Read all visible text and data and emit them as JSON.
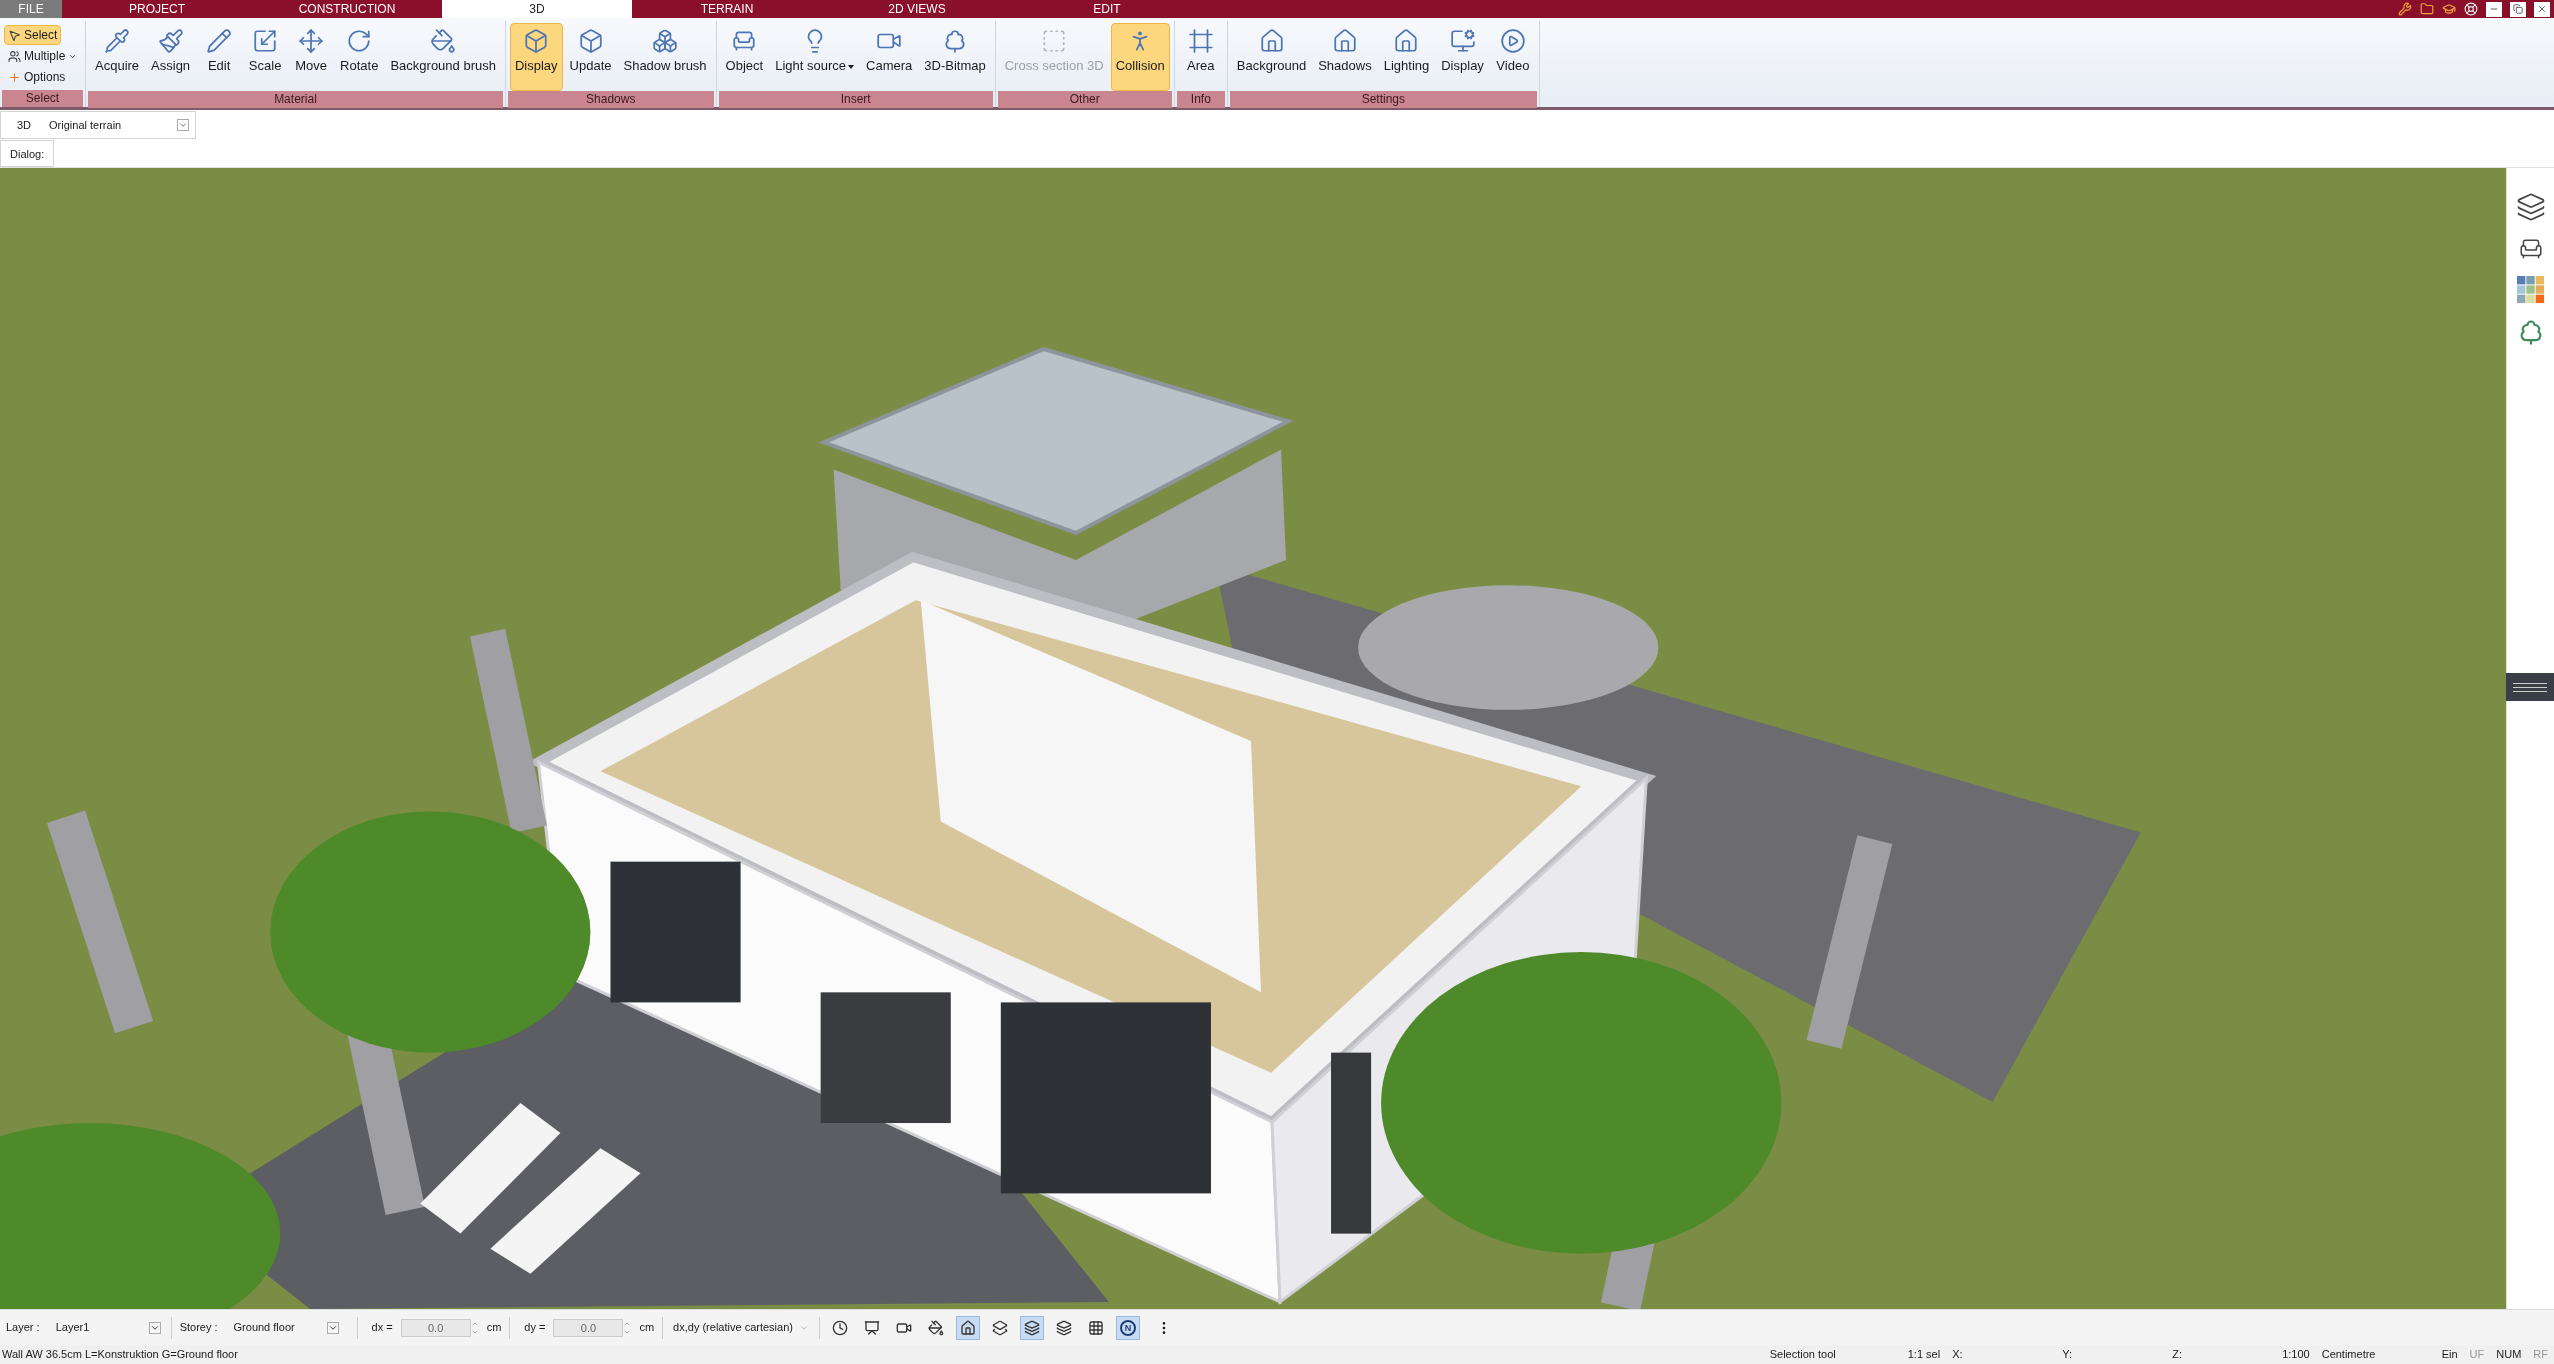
{
  "tabs": [
    {
      "label": "FILE",
      "selected": false,
      "kind": "file"
    },
    {
      "label": "PROJECT",
      "selected": false,
      "kind": "tab"
    },
    {
      "label": "CONSTRUCTION",
      "selected": false,
      "kind": "tab"
    },
    {
      "label": "3D",
      "selected": true,
      "kind": "tab"
    },
    {
      "label": "TERRAIN",
      "selected": false,
      "kind": "tab"
    },
    {
      "label": "2D VIEWS",
      "selected": false,
      "kind": "tab"
    },
    {
      "label": "EDIT",
      "selected": false,
      "kind": "tab"
    }
  ],
  "select_group": {
    "label": "Select",
    "items": [
      {
        "label": "Select",
        "selected": true
      },
      {
        "label": "Multiple",
        "selected": false,
        "dropdown": true
      },
      {
        "label": "Options",
        "selected": false,
        "dropdown": false
      }
    ]
  },
  "groups": [
    {
      "label": "Material",
      "buttons": [
        {
          "label": "Acquire",
          "selected": false,
          "disabled": false
        },
        {
          "label": "Assign",
          "selected": false,
          "disabled": false
        },
        {
          "label": "Edit",
          "selected": false,
          "disabled": false
        },
        {
          "label": "Scale",
          "selected": false,
          "disabled": false
        },
        {
          "label": "Move",
          "selected": false,
          "disabled": false
        },
        {
          "label": "Rotate",
          "selected": false,
          "disabled": false
        },
        {
          "label": "Background brush",
          "selected": false,
          "disabled": false
        }
      ]
    },
    {
      "label": "Shadows",
      "buttons": [
        {
          "label": "Display",
          "selected": true,
          "disabled": false
        },
        {
          "label": "Update",
          "selected": false,
          "disabled": false
        },
        {
          "label": "Shadow brush",
          "selected": false,
          "disabled": false
        }
      ]
    },
    {
      "label": "Insert",
      "buttons": [
        {
          "label": "Object",
          "selected": false,
          "disabled": false
        },
        {
          "label": "Light source",
          "selected": false,
          "disabled": false,
          "dropdown": true
        },
        {
          "label": "Camera",
          "selected": false,
          "disabled": false
        },
        {
          "label": "3D-Bitmap",
          "selected": false,
          "disabled": false
        }
      ]
    },
    {
      "label": "Other",
      "buttons": [
        {
          "label": "Cross section 3D",
          "selected": false,
          "disabled": true
        },
        {
          "label": "Collision",
          "selected": true,
          "disabled": false
        }
      ]
    },
    {
      "label": "Info",
      "buttons": [
        {
          "label": "Area",
          "selected": false,
          "disabled": false
        }
      ]
    },
    {
      "label": "Settings",
      "buttons": [
        {
          "label": "Background",
          "selected": false,
          "disabled": false
        },
        {
          "label": "Shadows",
          "selected": false,
          "disabled": false
        },
        {
          "label": "Lighting",
          "selected": false,
          "disabled": false
        },
        {
          "label": "Display",
          "selected": false,
          "disabled": false
        },
        {
          "label": "Video",
          "selected": false,
          "disabled": false
        }
      ]
    }
  ],
  "view_bar": {
    "label": "3D",
    "value": "Original terrain"
  },
  "dialog_bar": {
    "label": "Dialog:"
  },
  "toolbar": {
    "layer": {
      "label": "Layer :",
      "value": "Layer1"
    },
    "storey": {
      "label": "Storey :",
      "value": "Ground floor"
    },
    "dx": {
      "label": "dx =",
      "value": "0.0",
      "unit": "cm"
    },
    "dy": {
      "label": "dy =",
      "value": "0.0",
      "unit": "cm"
    },
    "mode": "dx,dy (relative cartesian)",
    "tools": [
      {
        "selected": false
      },
      {
        "selected": false
      },
      {
        "selected": false
      },
      {
        "selected": false
      },
      {
        "selected": true
      },
      {
        "selected": false
      },
      {
        "selected": true
      },
      {
        "selected": false
      },
      {
        "selected": false
      }
    ],
    "north": {
      "label": "N",
      "selected": true
    }
  },
  "status_bar": {
    "message": "Wall AW 36.5cm L=Konstruktion G=Ground floor",
    "cells": [
      {
        "text": "Selection tool",
        "disabled": false
      },
      {
        "text": "1:1 sel",
        "disabled": false
      },
      {
        "text": "X:",
        "disabled": false
      },
      {
        "text": "Y:",
        "disabled": false
      },
      {
        "text": "Z:",
        "disabled": false
      },
      {
        "text": "1:100",
        "disabled": false
      },
      {
        "text": "Centimetre",
        "disabled": false
      },
      {
        "text": "Ein",
        "disabled": false
      },
      {
        "text": "UF",
        "disabled": true
      },
      {
        "text": "NUM",
        "disabled": false
      },
      {
        "text": "RF",
        "disabled": true
      }
    ]
  }
}
